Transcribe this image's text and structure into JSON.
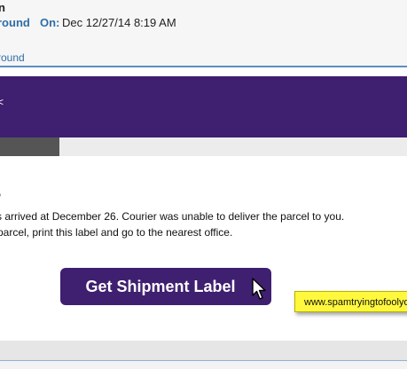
{
  "header": {
    "from_name": "n",
    "sender": "round",
    "on_label": "On:",
    "date": "Dec 12/27/14 8:19 AM",
    "to_link": "round"
  },
  "banner": {
    "glyph": "<",
    "color": "#3f1f70"
  },
  "message": {
    "greeting": ",",
    "line1": "s arrived at December 26. Courier was unable to deliver the parcel to you.",
    "line2": " parcel, print this label and go to the nearest office."
  },
  "cta": {
    "label": "Get Shipment Label"
  },
  "tooltip": {
    "text": "www.spamtryingtofoolyou"
  },
  "colors": {
    "link": "#2f6ea6",
    "tooltip_bg": "#fff83d"
  }
}
